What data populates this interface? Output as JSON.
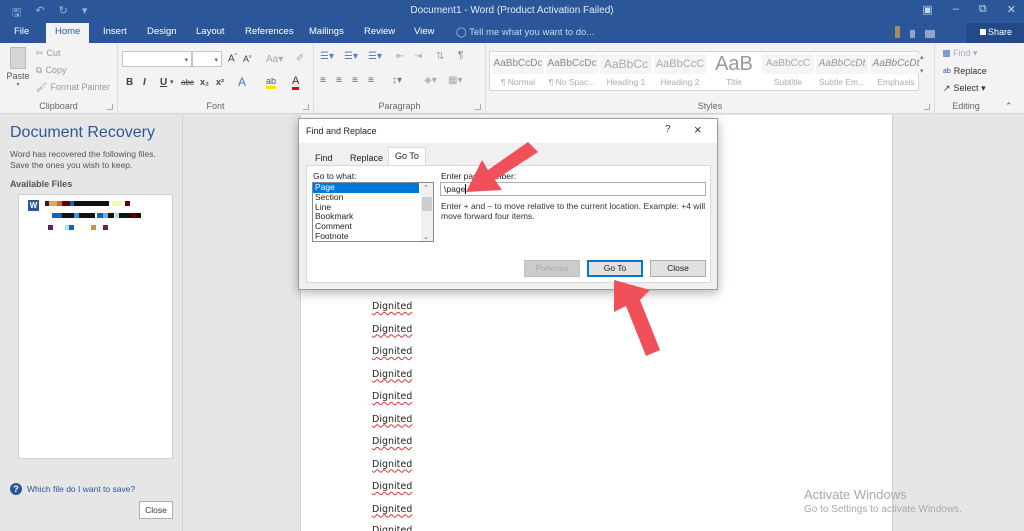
{
  "window": {
    "title": "Document1 - Word (Product Activation Failed)",
    "qat_icons": [
      "save-icon",
      "undo-icon",
      "redo-icon",
      "customize-icon"
    ],
    "controls": [
      "ribbon-display-icon",
      "minimize-icon",
      "restore-icon",
      "close-icon"
    ]
  },
  "tabs": [
    {
      "label": "File"
    },
    {
      "label": "Home",
      "active": true
    },
    {
      "label": "Insert"
    },
    {
      "label": "Design"
    },
    {
      "label": "Layout"
    },
    {
      "label": "References"
    },
    {
      "label": "Mailings"
    },
    {
      "label": "Review"
    },
    {
      "label": "View"
    }
  ],
  "tell_me": "Tell me what you want to do...",
  "share_label": "Share",
  "ribbon": {
    "clipboard": {
      "label": "Clipboard",
      "paste": "Paste",
      "cut": "Cut",
      "copy": "Copy",
      "format_painter": "Format Painter"
    },
    "font": {
      "label": "Font",
      "font_name": "",
      "font_size": "",
      "bold": "B",
      "italic": "I",
      "underline": "U",
      "strike": "abc",
      "sub": "x₂",
      "sup": "x²"
    },
    "paragraph": {
      "label": "Paragraph"
    },
    "styles": {
      "label": "Styles",
      "items": [
        {
          "sample": "AaBbCcDc",
          "name": "¶ Normal"
        },
        {
          "sample": "AaBbCcDc",
          "name": "¶ No Spac..."
        },
        {
          "sample": "AaBbCc",
          "name": "Heading 1"
        },
        {
          "sample": "AaBbCcC",
          "name": "Heading 2"
        },
        {
          "sample": "AaB",
          "name": "Title"
        },
        {
          "sample": "AaBbCcC",
          "name": "Subtitle"
        },
        {
          "sample": "AaBbCcDt",
          "name": "Subtle Em..."
        },
        {
          "sample": "AaBbCcDt",
          "name": "Emphasis"
        }
      ]
    },
    "editing": {
      "label": "Editing",
      "find": "Find",
      "replace": "Replace",
      "select": "Select"
    }
  },
  "recovery": {
    "title": "Document Recovery",
    "description_1": "Word has recovered the following files.",
    "description_2": "Save the ones you wish to keep.",
    "available_files": "Available Files",
    "help_link": "Which file do I want to save?",
    "close": "Close"
  },
  "document": {
    "lines": [
      "Dignited",
      "Dignited",
      "Dignited",
      "Dignited",
      "Dignited",
      "Dignited",
      "Dignited",
      "Dignited",
      "Dignited",
      "Dignited"
    ]
  },
  "dialog": {
    "title": "Find and Replace",
    "help": "?",
    "close_icon": "×",
    "tabs": [
      {
        "label": "Find"
      },
      {
        "label": "Replace"
      },
      {
        "label": "Go To",
        "active": true
      }
    ],
    "goto_what_label": "Go to what:",
    "goto_items": [
      "Page",
      "Section",
      "Line",
      "Bookmark",
      "Comment",
      "Footnote"
    ],
    "goto_selected": "Page",
    "enter_label": "Enter page number:",
    "enter_value": "\\page",
    "hint": "Enter + and – to move relative to the current location. Example: +4 will move forward four items.",
    "buttons": {
      "previous": "Previous",
      "goto": "Go To",
      "close": "Close"
    }
  },
  "watermark": {
    "line1": "Activate Windows",
    "line2": "Go to Settings to activate Windows."
  },
  "annotation_color": "#f0505a"
}
